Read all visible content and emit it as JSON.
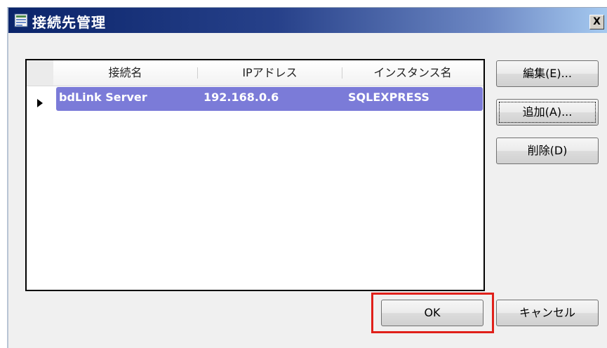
{
  "window": {
    "title": "接続先管理",
    "close_label": "X"
  },
  "grid": {
    "columns": [
      "接続名",
      "IPアドレス",
      "インスタンス名"
    ],
    "rows": [
      {
        "name": "bdLink Server",
        "ip": "192.168.0.6",
        "instance": "SQLEXPRESS"
      }
    ]
  },
  "buttons": {
    "edit": "編集(E)...",
    "add": "追加(A)...",
    "delete": "削除(D)",
    "ok": "OK",
    "cancel": "キャンセル"
  },
  "colors": {
    "selected_row": "#7b7bd8",
    "highlight_box": "#e0201a",
    "titlebar_start": "#0a246a"
  }
}
